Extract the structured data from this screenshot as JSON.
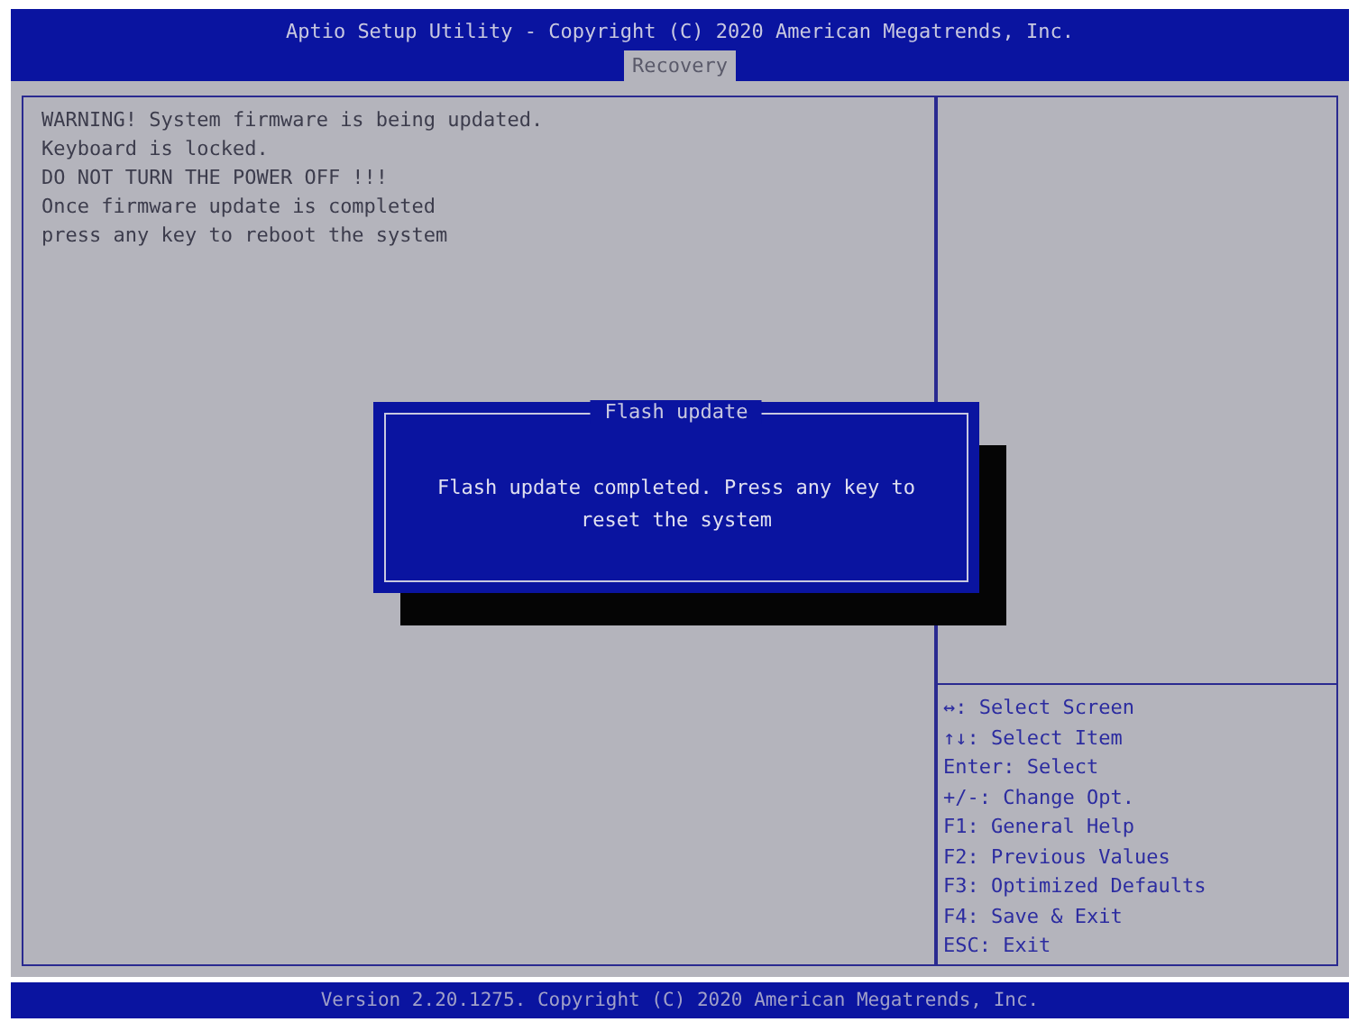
{
  "header": {
    "title": "Aptio Setup Utility - Copyright (C) 2020 American Megatrends, Inc."
  },
  "tabs": [
    {
      "label": "Recovery",
      "selected": true
    }
  ],
  "messages": [
    "WARNING! System firmware is being updated.",
    "Keyboard is locked.",
    "DO NOT TURN THE POWER OFF !!!",
    "Once firmware update is completed",
    "press any key to reboot the system"
  ],
  "dialog": {
    "title": "Flash update",
    "message": "Flash update completed. Press any key to reset the system"
  },
  "help": [
    "↔: Select Screen",
    "↑↓: Select Item",
    "Enter: Select",
    "+/-: Change Opt.",
    "F1: General Help",
    "F2: Previous Values",
    "F3: Optimized Defaults",
    "F4: Save & Exit",
    "ESC: Exit"
  ],
  "footer": "Version 2.20.1275. Copyright (C) 2020 American Megatrends, Inc."
}
